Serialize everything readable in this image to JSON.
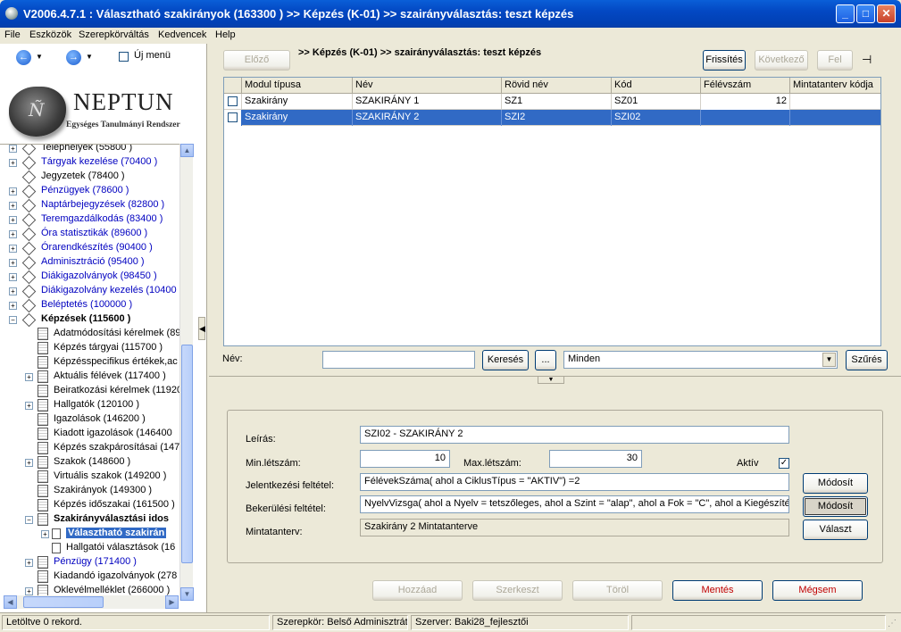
{
  "window": {
    "title": "V2006.4.7.1 : Választható szakirányok (163300  )  >> Képzés (K-01) >> szairányválasztás: teszt képzés"
  },
  "menu": [
    "File",
    "Eszközök",
    "Szerepkörváltás",
    "Kedvencek",
    "Help"
  ],
  "nav": {
    "back_icon": "back-arrow-icon",
    "forward_icon": "forward-arrow-icon",
    "new_menu_label": "Új menü"
  },
  "logo": {
    "name": "NEPTUN",
    "subtitle": "Egységes Tanulmányi Rendszer"
  },
  "tree": [
    {
      "label": "Telephelyek (55800  )",
      "expander": "+",
      "color": "#000000",
      "bold": false
    },
    {
      "label": "Tárgyak kezelése (70400  )",
      "expander": "+",
      "color": "#0000c0",
      "bold": false
    },
    {
      "label": "Jegyzetek (78400  )",
      "expander": "",
      "color": "#000000",
      "bold": false
    },
    {
      "label": "Pénzügyek (78600  )",
      "expander": "+",
      "color": "#0000c0",
      "bold": false
    },
    {
      "label": "Naptárbejegyzések (82800  )",
      "expander": "+",
      "color": "#0000c0",
      "bold": false
    },
    {
      "label": "Teremgazdálkodás (83400  )",
      "expander": "+",
      "color": "#0000c0",
      "bold": false
    },
    {
      "label": "Óra statisztikák (89600  )",
      "expander": "+",
      "color": "#0000c0",
      "bold": false
    },
    {
      "label": "Órarendkészítés (90400  )",
      "expander": "+",
      "color": "#0000c0",
      "bold": false
    },
    {
      "label": "Adminisztráció (95400  )",
      "expander": "+",
      "color": "#0000c0",
      "bold": false
    },
    {
      "label": "Diákigazolványok (98450  )",
      "expander": "+",
      "color": "#0000c0",
      "bold": false
    },
    {
      "label": "Diákigazolvány kezelés (10400",
      "expander": "+",
      "color": "#0000c0",
      "bold": false
    },
    {
      "label": "Beléptetés (100000  )",
      "expander": "+",
      "color": "#0000c0",
      "bold": false
    },
    {
      "label": "Képzések (115600  )",
      "expander": "−",
      "color": "#000000",
      "bold": true
    },
    {
      "label": "Adatmódosítási kérelmek (89",
      "expander": "",
      "color": "#000000",
      "bold": false
    },
    {
      "label": "Képzés tárgyai (115700  )",
      "expander": "",
      "color": "#000000",
      "bold": false
    },
    {
      "label": "Képzésspecifikus értékek,ac",
      "expander": "",
      "color": "#000000",
      "bold": false
    },
    {
      "label": "Aktuális félévek (117400  )",
      "expander": "+",
      "color": "#000000",
      "bold": false
    },
    {
      "label": "Beiratkozási kérelmek (11920",
      "expander": "",
      "color": "#000000",
      "bold": false
    },
    {
      "label": "Hallgatók (120100  )",
      "expander": "+",
      "color": "#000000",
      "bold": false
    },
    {
      "label": "Igazolások (146200  )",
      "expander": "",
      "color": "#000000",
      "bold": false
    },
    {
      "label": "Kiadott igazolások (146400",
      "expander": "",
      "color": "#000000",
      "bold": false
    },
    {
      "label": "Képzés szakpárosításai (147",
      "expander": "",
      "color": "#000000",
      "bold": false
    },
    {
      "label": "Szakok (148600  )",
      "expander": "+",
      "color": "#000000",
      "bold": false
    },
    {
      "label": "Virtuális szakok (149200  )",
      "expander": "",
      "color": "#000000",
      "bold": false
    },
    {
      "label": "Szakirányok (149300  )",
      "expander": "",
      "color": "#000000",
      "bold": false
    },
    {
      "label": "Képzés időszakai (161500  )",
      "expander": "",
      "color": "#000000",
      "bold": false
    },
    {
      "label": "Szakirányválasztási idos",
      "expander": "−",
      "color": "#000000",
      "bold": true
    },
    {
      "label": "Választható szakirán",
      "expander": "+",
      "color": "#ffffff",
      "bold": true
    },
    {
      "label": "Hallgatói választások (16",
      "expander": "",
      "color": "#000000",
      "bold": false
    },
    {
      "label": "Pénzügy (171400  )",
      "expander": "+",
      "color": "#0000c0",
      "bold": false
    },
    {
      "label": "Kiadandó igazolványok (278",
      "expander": "",
      "color": "#000000",
      "bold": false
    },
    {
      "label": "Oklevélmelléklet (266000  )",
      "expander": "+",
      "color": "#000000",
      "bold": false
    }
  ],
  "toolbar": {
    "prev_label": "Előző",
    "refresh_label": "Frissítés",
    "next_label": "Következő",
    "up_label": "Fel",
    "pin_icon": "pin-icon"
  },
  "breadcrumb": ">> Képzés (K-01) >> szairányválasztás: teszt képzés",
  "table": {
    "columns": [
      "Modul típusa",
      "Név",
      "Rövid név",
      "Kód",
      "Félévszám",
      "Mintatanterv kódja"
    ],
    "rows": [
      [
        "Szakirány",
        "SZAKIRÁNY 1",
        "SZ1",
        "SZ01",
        "12",
        ""
      ],
      [
        "Szakirány",
        "SZAKIRÁNY 2",
        "SZI2",
        "SZI02",
        "",
        ""
      ]
    ],
    "selected_row": 1
  },
  "filter": {
    "name_label": "Név:",
    "name_value": "",
    "search_label": "Keresés",
    "ellipsis_label": "...",
    "scope_value": "Minden",
    "filter_label": "Szűrés"
  },
  "detail": {
    "description_label": "Leírás:",
    "description_value": "SZI02 - SZAKIRÁNY 2",
    "min_label": "Min.létszám:",
    "min_value": "10",
    "max_label": "Max.létszám:",
    "max_value": "30",
    "active_label": "Aktív",
    "active_checked": true,
    "apply_cond_label": "Jelentkezési feltétel:",
    "apply_cond_value": "FélévekSzáma( ahol a CiklusTípus = \"AKTIV\") =2",
    "entry_cond_label": "Bekerülési feltétel:",
    "entry_cond_value": "NyelvVizsga( ahol a Nyelv = tetszőleges, ahol a Szint = \"alap\", ahol a Fok = \"C\", ahol a Kiegészítés",
    "plan_label": "Mintatanterv:",
    "plan_value": "Szakirány 2 Mintatanterve",
    "modify1_label": "Módosít",
    "modify2_label": "Módosít",
    "choose_label": "Választ"
  },
  "actions": {
    "add_label": "Hozzáad",
    "edit_label": "Szerkeszt",
    "delete_label": "Töröl",
    "save_label": "Mentés",
    "cancel_label": "Mégsem"
  },
  "status": {
    "records": "Letöltve 0 rekord.",
    "role": "Szerepkör: Belső Adminisztrátor",
    "server": "Szerver: Baki28_fejlesztői"
  }
}
